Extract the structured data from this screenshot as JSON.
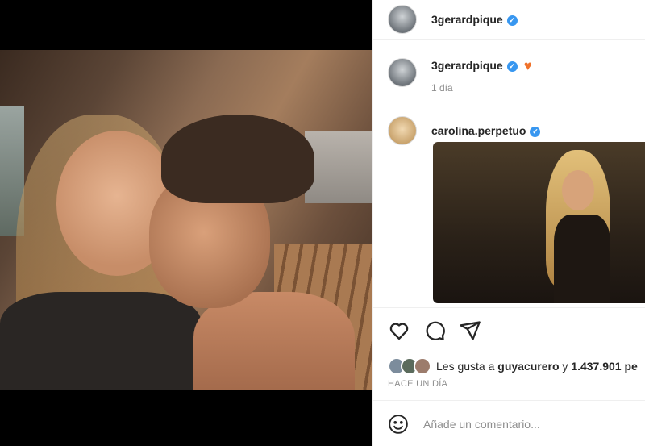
{
  "header": {
    "username": "3gerardpique",
    "verified_mark": "✓"
  },
  "caption": {
    "username": "3gerardpique",
    "verified_mark": "✓",
    "heart": "♥",
    "time": "1 día"
  },
  "comment": {
    "username": "carolina.perpetuo",
    "verified_mark": "✓"
  },
  "icons": [
    "heart-outline-icon",
    "comment-bubble-icon",
    "share-paper-plane-icon",
    "emoji-smile-icon"
  ],
  "likes": {
    "prefix": "Les gusta a ",
    "user": "guyacurero",
    "middle": " y ",
    "count": "1.437.901 pe"
  },
  "posted": "HACE UN DÍA",
  "add_comment": {
    "placeholder": "Añade un comentario..."
  },
  "colors": {
    "accent": "#3897f0",
    "heart": "#f0722a",
    "muted": "#8e8e8e"
  }
}
